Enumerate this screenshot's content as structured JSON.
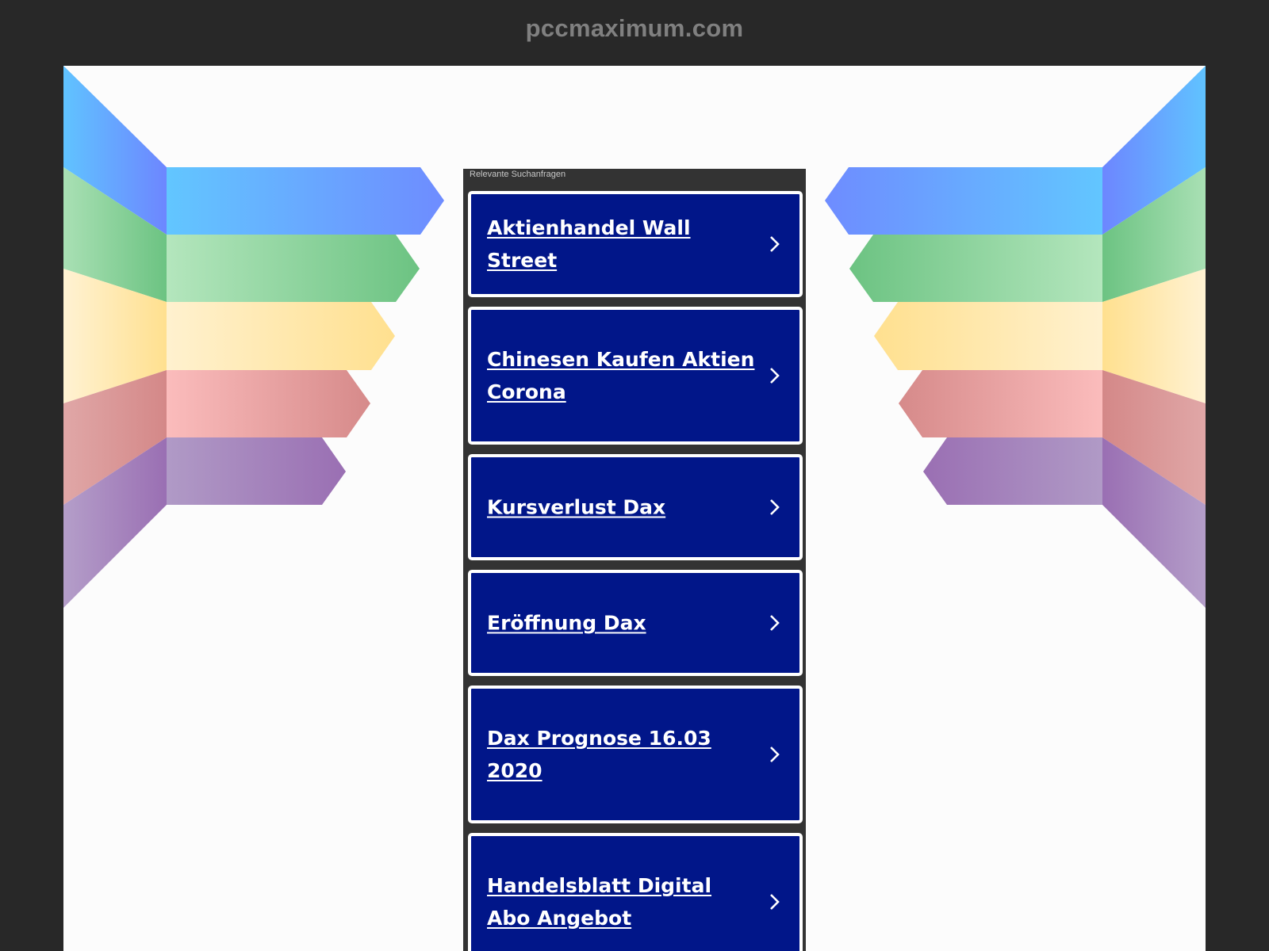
{
  "header": {
    "site_title": "pccmaximum.com"
  },
  "panel": {
    "label": "Relevante Suchanfragen",
    "links": [
      {
        "label": "Aktienhandel Wall Street"
      },
      {
        "label": "Chinesen Kaufen Aktien Corona"
      },
      {
        "label": "Kursverlust Dax"
      },
      {
        "label": "Eröffnung Dax"
      },
      {
        "label": "Dax Prognose 16.03 2020"
      },
      {
        "label": "Handelsblatt Digital Abo Angebot"
      }
    ]
  },
  "colors": {
    "background": "#282828",
    "content_bg": "#fcfcfc",
    "panel_bg": "#333333",
    "link_bg": "#011689",
    "link_text": "#ffffff",
    "title_text": "#808080",
    "ribbon_blue": "#62b9ff",
    "ribbon_green": "#6cc382",
    "ribbon_yellow": "#ffe3a1",
    "ribbon_red": "#f7b5b5",
    "ribbon_purple": "#9b74b6"
  },
  "icons": {
    "link_arrow": "chevron-right-icon"
  }
}
